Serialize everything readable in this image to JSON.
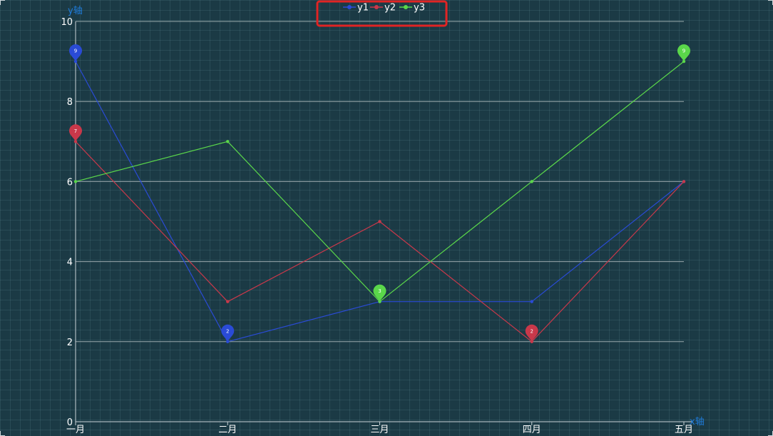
{
  "chart_data": {
    "type": "line",
    "categories": [
      "一月",
      "二月",
      "三月",
      "四月",
      "五月"
    ],
    "series": [
      {
        "name": "y1",
        "color": "#2a4bd6",
        "values": [
          9,
          2,
          3,
          3,
          6
        ]
      },
      {
        "name": "y2",
        "color": "#c9384a",
        "values": [
          7,
          3,
          5,
          2,
          6
        ]
      },
      {
        "name": "y3",
        "color": "#5ad74a",
        "values": [
          6,
          7,
          3,
          6,
          9
        ]
      }
    ],
    "markers": [
      {
        "series": "y1",
        "category": "一月",
        "value": 9,
        "label": "9"
      },
      {
        "series": "y1",
        "category": "二月",
        "value": 2,
        "label": "2"
      },
      {
        "series": "y2",
        "category": "一月",
        "value": 7,
        "label": "7"
      },
      {
        "series": "y2",
        "category": "四月",
        "value": 2,
        "label": "2"
      },
      {
        "series": "y3",
        "category": "三月",
        "value": 3,
        "label": "3"
      },
      {
        "series": "y3",
        "category": "五月",
        "value": 9,
        "label": "9"
      }
    ],
    "ylim": [
      0,
      10
    ],
    "yticks": [
      0,
      2,
      4,
      6,
      8,
      10
    ],
    "xlabel": "x轴",
    "ylabel": "y轴",
    "legend_position": "top-center",
    "legend_highlighted": true,
    "grid": true
  },
  "colors": {
    "background": "#1b3a45",
    "axis": "#c8d2d6",
    "gridline": "#9aa9ad",
    "axis_name": "#1e7ad8",
    "tick_text": "#ffffff",
    "legend_text": "#ffffff",
    "highlight": "#e02424"
  }
}
